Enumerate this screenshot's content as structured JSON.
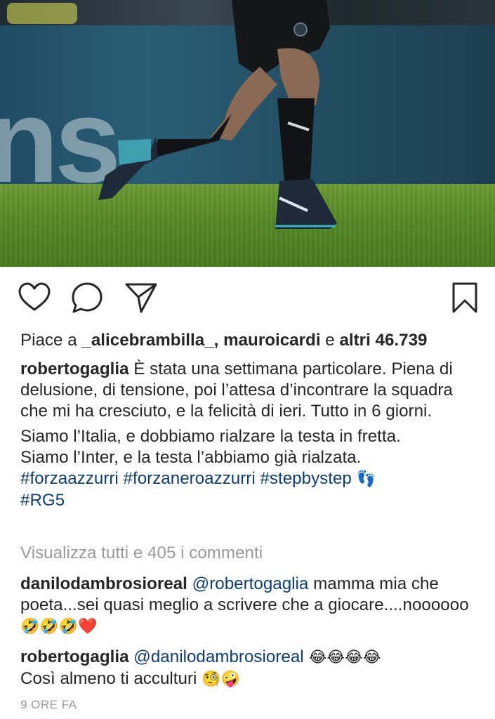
{
  "post": {
    "likes": {
      "prefix": "Piace a ",
      "user1": "_alicebrambilla_",
      "sep": ", ",
      "user2": "mauroicardi",
      "and": " e ",
      "others": "altri 46.739"
    },
    "caption": {
      "username": "robertogaglia",
      "para1": " È stata una settimana particolare. Piena di delusione, di tensione, poi l’attesa d’incontrare la squadra che mi ha cresciuto, e la felicità di ieri. Tutto in 6 giorni.",
      "para2_line1": "Siamo l’Italia, e dobbiamo rialzare la testa in fretta.",
      "para2_line2": "Siamo l’Inter, e la testa l’abbiamo già rialzata.",
      "hashtags": "#forzaazzurri #forzaneroazzurri #stepbystep",
      "hashtag_emoji": "👣",
      "hashtag2": "#RG5"
    },
    "view_all_comments": "Visualizza tutti e 405 i commenti",
    "comments": [
      {
        "username": "danilodambrosioreal",
        "mention": "@robertogaglia",
        "text": " mamma mia che poeta...sei quasi meglio a scrivere che a giocare....noooooo",
        "emojis": "🤣🤣🤣❤️"
      },
      {
        "username": "robertogaglia",
        "mention": "@danilodambrosioreal",
        "emojis1": " 😂😂😂😂",
        "text": "Così almeno ti acculturi ",
        "emojis2": "🧐🤪"
      }
    ],
    "timestamp": "9 ORE FA"
  },
  "icons": {
    "like": "heart-icon",
    "comment": "comment-bubble-icon",
    "share": "paper-plane-icon",
    "save": "bookmark-icon"
  },
  "colors": {
    "text": "#262626",
    "link": "#0d3e73",
    "muted": "#999999"
  }
}
